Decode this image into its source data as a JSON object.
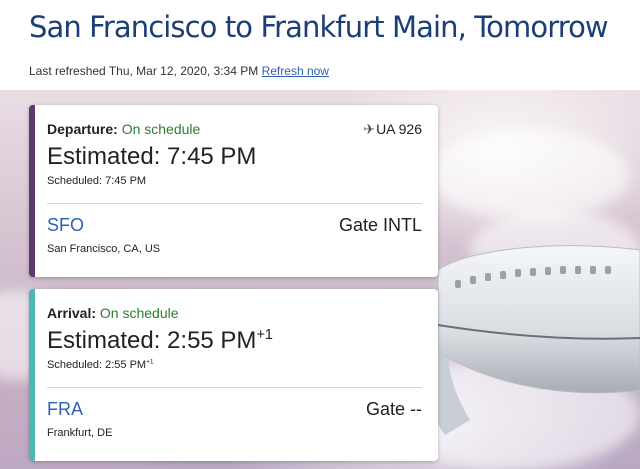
{
  "header": {
    "title": "San Francisco to Frankfurt Main, Tomorrow",
    "last_refreshed": "Last refreshed Thu, Mar 12, 2020, 3:34 PM",
    "refresh_link": "Refresh now"
  },
  "departure": {
    "status_label": "Departure:",
    "status_value": "On schedule",
    "flight_icon": "airplane-icon",
    "flight_number": "UA 926",
    "estimated": "Estimated: 7:45 PM",
    "scheduled": "Scheduled: 7:45 PM",
    "airport_code": "SFO",
    "gate": "Gate INTL",
    "city": "San Francisco, CA, US",
    "accent_color": "#5b3a6e"
  },
  "arrival": {
    "status_label": "Arrival:",
    "status_value": "On schedule",
    "estimated": "Estimated: 2:55 PM",
    "estimated_day_offset": "+1",
    "scheduled": "Scheduled: 2:55 PM",
    "scheduled_day_offset": "+1",
    "airport_code": "FRA",
    "gate": "Gate --",
    "city": "Frankfurt, DE",
    "accent_color": "#4db7b3"
  },
  "colors": {
    "title": "#1c3e78",
    "link": "#2f5fb5",
    "status_ok": "#2d7d2d"
  }
}
